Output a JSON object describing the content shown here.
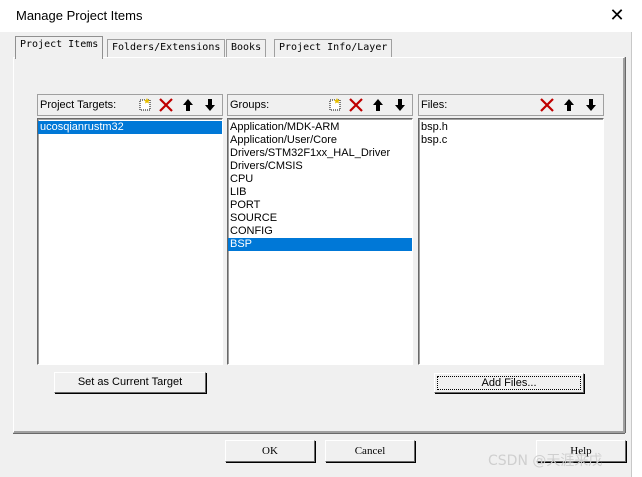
{
  "window": {
    "title": "Manage Project Items"
  },
  "tabs": [
    {
      "label": "Project Items",
      "active": true
    },
    {
      "label": "Folders/Extensions",
      "active": false
    },
    {
      "label": "Books",
      "active": false
    },
    {
      "label": "Project Info/Layer",
      "active": false
    }
  ],
  "targets": {
    "label": "Project Targets:",
    "items": [
      {
        "text": "ucosqianrustm32",
        "selected": true
      }
    ],
    "set_current_label": "Set as Current Target"
  },
  "groups": {
    "label": "Groups:",
    "items": [
      {
        "text": "Application/MDK-ARM",
        "selected": false
      },
      {
        "text": "Application/User/Core",
        "selected": false
      },
      {
        "text": "Drivers/STM32F1xx_HAL_Driver",
        "selected": false
      },
      {
        "text": "Drivers/CMSIS",
        "selected": false
      },
      {
        "text": "CPU",
        "selected": false
      },
      {
        "text": "LIB",
        "selected": false
      },
      {
        "text": "PORT",
        "selected": false
      },
      {
        "text": "SOURCE",
        "selected": false
      },
      {
        "text": "CONFIG",
        "selected": false
      },
      {
        "text": "BSP",
        "selected": true
      }
    ]
  },
  "files": {
    "label": "Files:",
    "items": [
      {
        "text": "bsp.h"
      },
      {
        "text": "bsp.c"
      }
    ],
    "add_files_label": "Add Files..."
  },
  "footer": {
    "ok_label": "OK",
    "cancel_label": "Cancel",
    "help_label": "Help"
  },
  "watermark": "CSDN @天涯来戊",
  "colors": {
    "selection": "#0078d7",
    "delete_red": "#c00000"
  }
}
